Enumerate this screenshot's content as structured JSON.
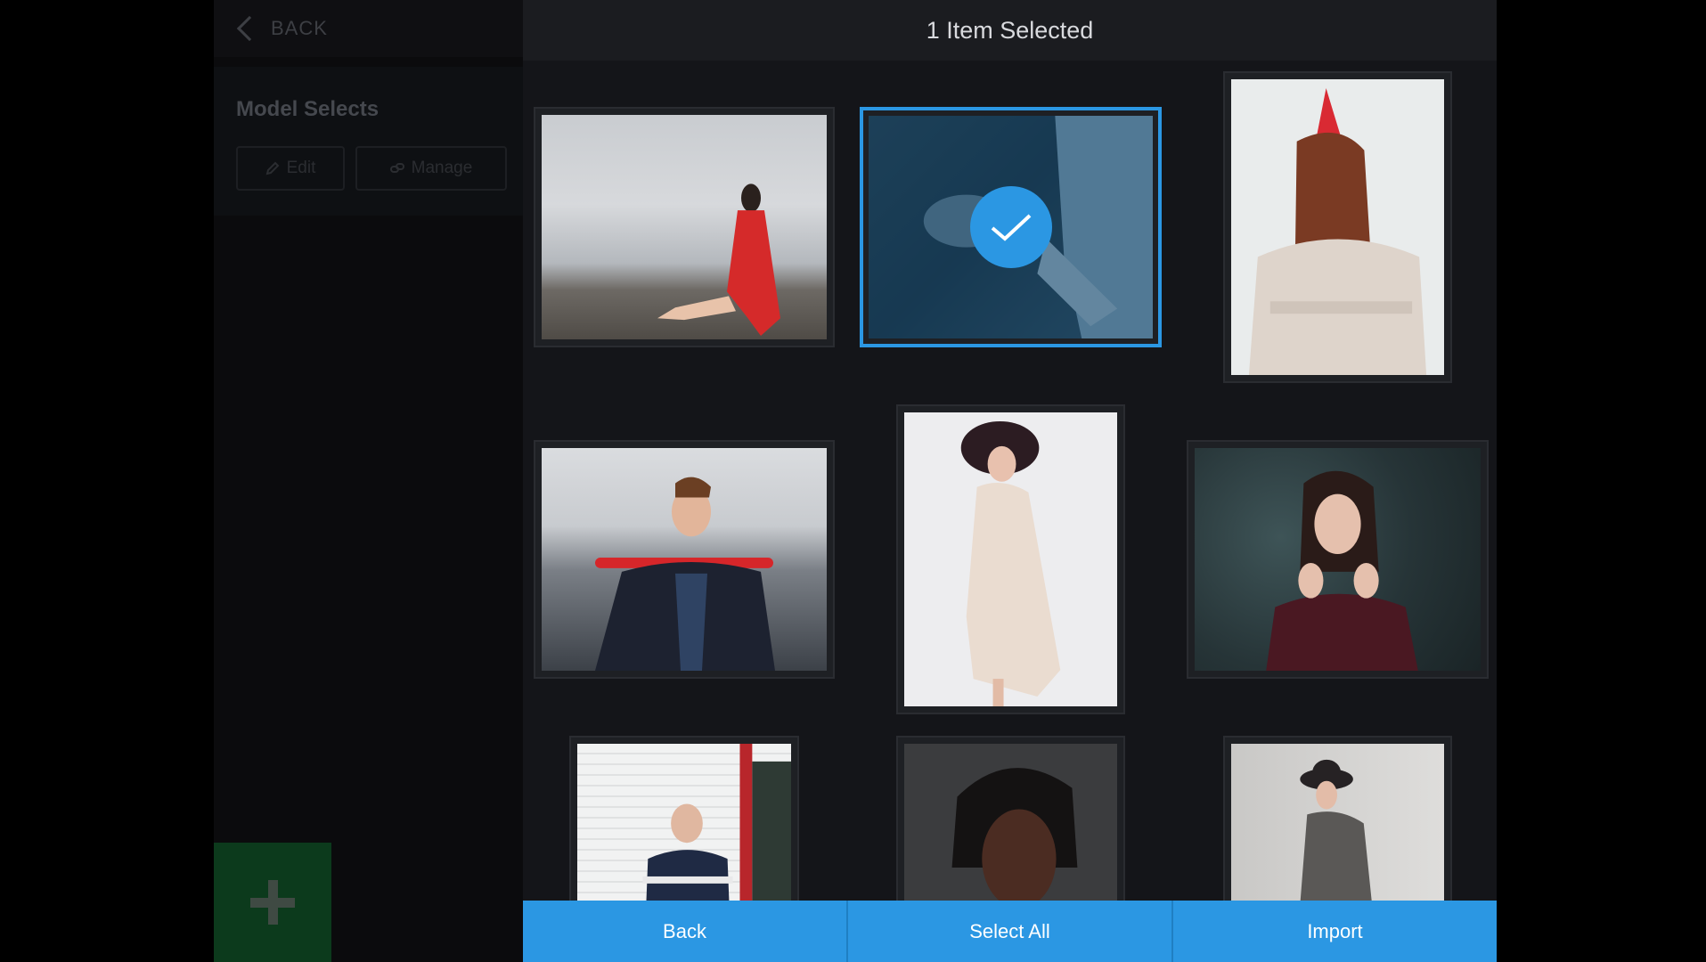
{
  "sidebar": {
    "back_label": "BACK",
    "album_title": "Model Selects",
    "edit_label": "Edit",
    "manage_label": "Manage"
  },
  "modal": {
    "title": "1 Item Selected"
  },
  "photos": [
    {
      "name": "photo-woman-red-dress-seaside",
      "selected": false
    },
    {
      "name": "photo-woman-lying-blue-shirt",
      "selected": true
    },
    {
      "name": "photo-woman-red-party-hat",
      "selected": false
    },
    {
      "name": "photo-man-red-umbrella-harbor",
      "selected": false
    },
    {
      "name": "photo-woman-white-dress-hat",
      "selected": false
    },
    {
      "name": "photo-woman-dark-foliage",
      "selected": false
    },
    {
      "name": "photo-man-white-siding",
      "selected": false
    },
    {
      "name": "photo-woman-braided-hair-portrait",
      "selected": false
    },
    {
      "name": "photo-woman-grey-coat-hat",
      "selected": false
    }
  ],
  "actions": {
    "back_label": "Back",
    "select_all_label": "Select All",
    "import_label": "Import"
  },
  "colors": {
    "accent": "#2b97e3",
    "modal_background": "#141519",
    "header_background": "#1b1c20",
    "add_button": "#0c3a1c"
  },
  "icons": {
    "back": "chevron-left-icon",
    "edit": "pencil-icon",
    "manage": "link-icon",
    "add": "plus-icon",
    "selected": "checkmark-icon"
  }
}
